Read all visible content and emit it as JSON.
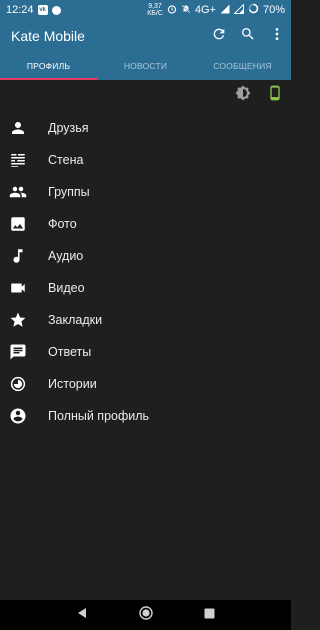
{
  "status_bar": {
    "time": "12:24",
    "speed_value": "9,37",
    "speed_unit": "КБ/С",
    "network": "4G+",
    "battery": "70%"
  },
  "app_bar": {
    "title": "Kate Mobile",
    "icons": [
      "refresh-icon",
      "search-icon",
      "more-vert-icon"
    ]
  },
  "tabs": [
    {
      "label": "ПРОФИЛЬ",
      "active": true
    },
    {
      "label": "НОВОСТИ",
      "active": false
    },
    {
      "label": "СООБЩЕНИЯ",
      "active": false
    }
  ],
  "toolbar": {
    "icons": [
      "brightness-icon",
      "phone-icon"
    ],
    "phone_color": "#8bc34a"
  },
  "menu": [
    {
      "label": "Друзья",
      "icon": "person-icon"
    },
    {
      "label": "Стена",
      "icon": "wall-icon"
    },
    {
      "label": "Группы",
      "icon": "groups-icon"
    },
    {
      "label": "Фото",
      "icon": "photo-icon"
    },
    {
      "label": "Аудио",
      "icon": "music-note-icon"
    },
    {
      "label": "Видео",
      "icon": "video-camera-icon"
    },
    {
      "label": "Закладки",
      "icon": "star-icon"
    },
    {
      "label": "Ответы",
      "icon": "chat-icon"
    },
    {
      "label": "Истории",
      "icon": "stories-icon"
    },
    {
      "label": "Полный профиль",
      "icon": "account-circle-icon"
    }
  ],
  "colors": {
    "primary": "#2c6d94",
    "background": "#1f1f1f",
    "tab_indicator": "#e23c6a"
  }
}
